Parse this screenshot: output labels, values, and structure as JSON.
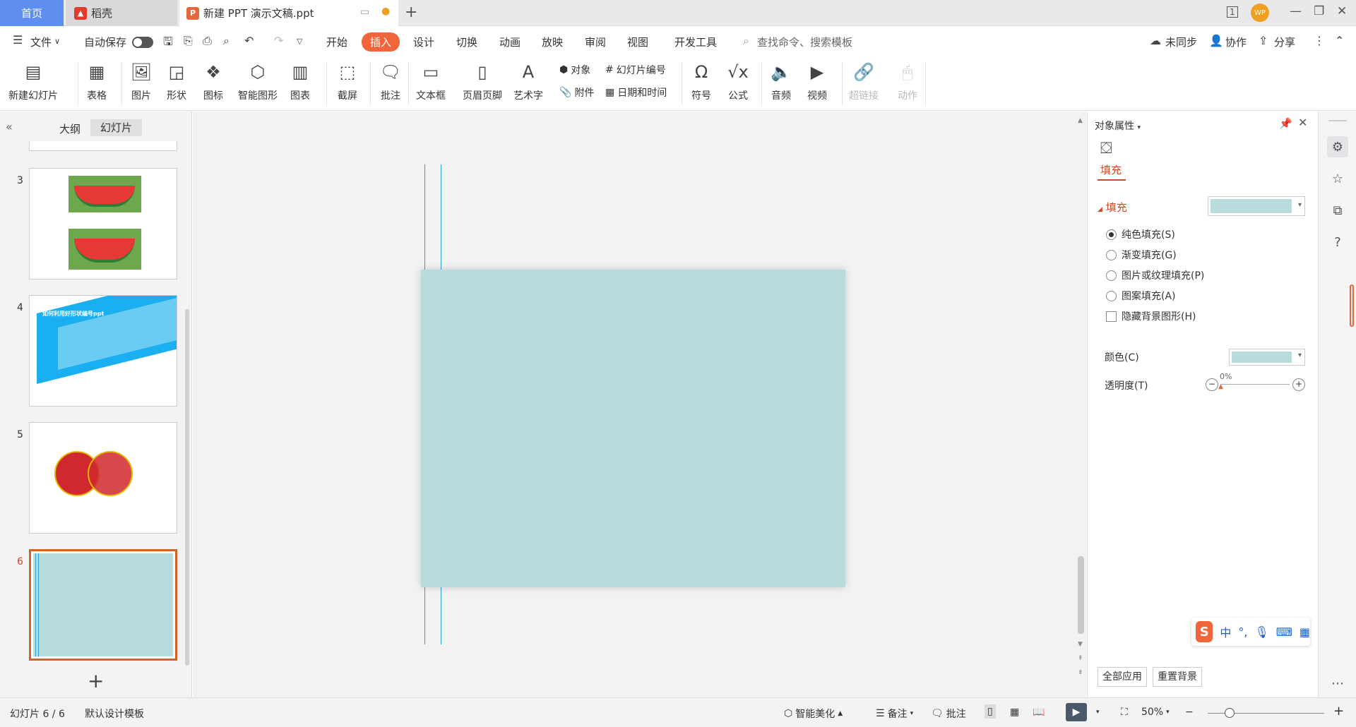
{
  "tabs": {
    "home": "首页",
    "docer": "稻壳",
    "document": "新建 PPT 演示文稿.ppt"
  },
  "window": {
    "new_tab": "+",
    "avatar": "WP",
    "layout_badge": "1"
  },
  "menu": {
    "file": "文件",
    "autosave": "自动保存",
    "items": [
      "开始",
      "插入",
      "设计",
      "切换",
      "动画",
      "放映",
      "审阅",
      "视图",
      "开发工具"
    ],
    "active": "插入",
    "search_placeholder": "查找命令、搜索模板",
    "unsynced": "未同步",
    "collaborate": "协作",
    "share": "分享"
  },
  "ribbon": {
    "new_slide": "新建幻灯片",
    "table": "表格",
    "picture": "图片",
    "shape": "形状",
    "icon": "图标",
    "smartart": "智能图形",
    "chart": "图表",
    "screenshot": "截屏",
    "comment": "批注",
    "textbox": "文本框",
    "header_footer": "页眉页脚",
    "wordart": "艺术字",
    "object": "对象",
    "slide_number": "幻灯片编号",
    "attachment": "附件",
    "datetime": "日期和时间",
    "symbol": "符号",
    "formula": "公式",
    "audio": "音频",
    "video": "视频",
    "hyperlink": "超链接",
    "action": "动作"
  },
  "left_panel": {
    "outline_tab": "大纲",
    "slides_tab": "幻灯片",
    "slides": [
      {
        "num": "3"
      },
      {
        "num": "4",
        "text": "如何利用好形状编号ppt"
      },
      {
        "num": "5"
      },
      {
        "num": "6"
      }
    ]
  },
  "props": {
    "title": "对象属性",
    "fill_tab": "填充",
    "fill_section": "填充",
    "options": [
      "纯色填充(S)",
      "渐变填充(G)",
      "图片或纹理填充(P)",
      "图案填充(A)"
    ],
    "hide_bg": "隐藏背景图形(H)",
    "color_label": "颜色(C)",
    "transparency_label": "透明度(T)",
    "transparency_value": "0%",
    "apply_all": "全部应用",
    "reset_bg": "重置背景",
    "fill_color": "#b8dcdc"
  },
  "ime": {
    "lang": "中",
    "punct": "°,"
  },
  "status": {
    "slide_counter": "幻灯片 6 / 6",
    "template": "默认设计模板",
    "beautify": "智能美化",
    "notes": "备注",
    "comments": "批注",
    "zoom": "50%"
  }
}
